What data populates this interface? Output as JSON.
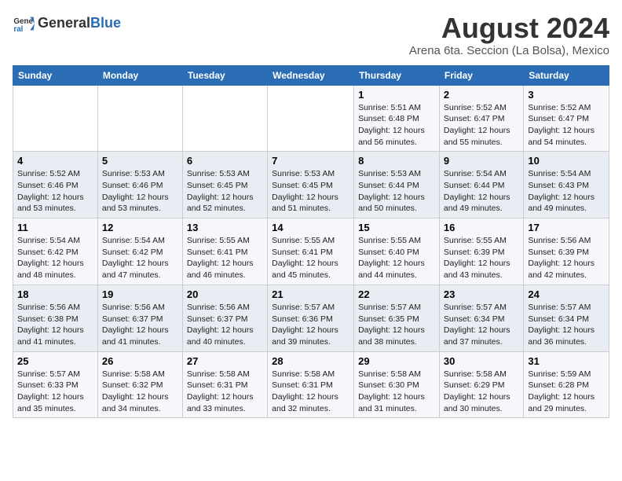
{
  "logo": {
    "general": "General",
    "blue": "Blue"
  },
  "title": "August 2024",
  "subtitle": "Arena 6ta. Seccion (La Bolsa), Mexico",
  "days": [
    "Sunday",
    "Monday",
    "Tuesday",
    "Wednesday",
    "Thursday",
    "Friday",
    "Saturday"
  ],
  "weeks": [
    [
      {
        "day": "",
        "content": ""
      },
      {
        "day": "",
        "content": ""
      },
      {
        "day": "",
        "content": ""
      },
      {
        "day": "",
        "content": ""
      },
      {
        "day": "1",
        "content": "Sunrise: 5:51 AM\nSunset: 6:48 PM\nDaylight: 12 hours\nand 56 minutes."
      },
      {
        "day": "2",
        "content": "Sunrise: 5:52 AM\nSunset: 6:47 PM\nDaylight: 12 hours\nand 55 minutes."
      },
      {
        "day": "3",
        "content": "Sunrise: 5:52 AM\nSunset: 6:47 PM\nDaylight: 12 hours\nand 54 minutes."
      }
    ],
    [
      {
        "day": "4",
        "content": "Sunrise: 5:52 AM\nSunset: 6:46 PM\nDaylight: 12 hours\nand 53 minutes."
      },
      {
        "day": "5",
        "content": "Sunrise: 5:53 AM\nSunset: 6:46 PM\nDaylight: 12 hours\nand 53 minutes."
      },
      {
        "day": "6",
        "content": "Sunrise: 5:53 AM\nSunset: 6:45 PM\nDaylight: 12 hours\nand 52 minutes."
      },
      {
        "day": "7",
        "content": "Sunrise: 5:53 AM\nSunset: 6:45 PM\nDaylight: 12 hours\nand 51 minutes."
      },
      {
        "day": "8",
        "content": "Sunrise: 5:53 AM\nSunset: 6:44 PM\nDaylight: 12 hours\nand 50 minutes."
      },
      {
        "day": "9",
        "content": "Sunrise: 5:54 AM\nSunset: 6:44 PM\nDaylight: 12 hours\nand 49 minutes."
      },
      {
        "day": "10",
        "content": "Sunrise: 5:54 AM\nSunset: 6:43 PM\nDaylight: 12 hours\nand 49 minutes."
      }
    ],
    [
      {
        "day": "11",
        "content": "Sunrise: 5:54 AM\nSunset: 6:42 PM\nDaylight: 12 hours\nand 48 minutes."
      },
      {
        "day": "12",
        "content": "Sunrise: 5:54 AM\nSunset: 6:42 PM\nDaylight: 12 hours\nand 47 minutes."
      },
      {
        "day": "13",
        "content": "Sunrise: 5:55 AM\nSunset: 6:41 PM\nDaylight: 12 hours\nand 46 minutes."
      },
      {
        "day": "14",
        "content": "Sunrise: 5:55 AM\nSunset: 6:41 PM\nDaylight: 12 hours\nand 45 minutes."
      },
      {
        "day": "15",
        "content": "Sunrise: 5:55 AM\nSunset: 6:40 PM\nDaylight: 12 hours\nand 44 minutes."
      },
      {
        "day": "16",
        "content": "Sunrise: 5:55 AM\nSunset: 6:39 PM\nDaylight: 12 hours\nand 43 minutes."
      },
      {
        "day": "17",
        "content": "Sunrise: 5:56 AM\nSunset: 6:39 PM\nDaylight: 12 hours\nand 42 minutes."
      }
    ],
    [
      {
        "day": "18",
        "content": "Sunrise: 5:56 AM\nSunset: 6:38 PM\nDaylight: 12 hours\nand 41 minutes."
      },
      {
        "day": "19",
        "content": "Sunrise: 5:56 AM\nSunset: 6:37 PM\nDaylight: 12 hours\nand 41 minutes."
      },
      {
        "day": "20",
        "content": "Sunrise: 5:56 AM\nSunset: 6:37 PM\nDaylight: 12 hours\nand 40 minutes."
      },
      {
        "day": "21",
        "content": "Sunrise: 5:57 AM\nSunset: 6:36 PM\nDaylight: 12 hours\nand 39 minutes."
      },
      {
        "day": "22",
        "content": "Sunrise: 5:57 AM\nSunset: 6:35 PM\nDaylight: 12 hours\nand 38 minutes."
      },
      {
        "day": "23",
        "content": "Sunrise: 5:57 AM\nSunset: 6:34 PM\nDaylight: 12 hours\nand 37 minutes."
      },
      {
        "day": "24",
        "content": "Sunrise: 5:57 AM\nSunset: 6:34 PM\nDaylight: 12 hours\nand 36 minutes."
      }
    ],
    [
      {
        "day": "25",
        "content": "Sunrise: 5:57 AM\nSunset: 6:33 PM\nDaylight: 12 hours\nand 35 minutes."
      },
      {
        "day": "26",
        "content": "Sunrise: 5:58 AM\nSunset: 6:32 PM\nDaylight: 12 hours\nand 34 minutes."
      },
      {
        "day": "27",
        "content": "Sunrise: 5:58 AM\nSunset: 6:31 PM\nDaylight: 12 hours\nand 33 minutes."
      },
      {
        "day": "28",
        "content": "Sunrise: 5:58 AM\nSunset: 6:31 PM\nDaylight: 12 hours\nand 32 minutes."
      },
      {
        "day": "29",
        "content": "Sunrise: 5:58 AM\nSunset: 6:30 PM\nDaylight: 12 hours\nand 31 minutes."
      },
      {
        "day": "30",
        "content": "Sunrise: 5:58 AM\nSunset: 6:29 PM\nDaylight: 12 hours\nand 30 minutes."
      },
      {
        "day": "31",
        "content": "Sunrise: 5:59 AM\nSunset: 6:28 PM\nDaylight: 12 hours\nand 29 minutes."
      }
    ]
  ]
}
